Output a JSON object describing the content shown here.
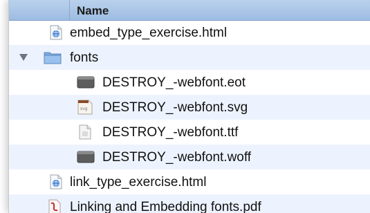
{
  "header": {
    "name_label": "Name"
  },
  "files": [
    {
      "label": "embed_type_exercise.html",
      "icon": "html-file-icon"
    },
    {
      "label": "fonts",
      "icon": "folder-icon",
      "expanded": true
    },
    {
      "label": "DESTROY_-webfont.eot",
      "icon": "eot-file-icon"
    },
    {
      "label": "DESTROY_-webfont.svg",
      "icon": "svg-file-icon"
    },
    {
      "label": "DESTROY_-webfont.ttf",
      "icon": "ttf-file-icon"
    },
    {
      "label": "DESTROY_-webfont.woff",
      "icon": "woff-file-icon"
    },
    {
      "label": "link_type_exercise.html",
      "icon": "html-file-icon"
    },
    {
      "label": "Linking and Embedding fonts.pdf",
      "icon": "pdf-file-icon"
    }
  ],
  "colors": {
    "header_gradient_top": "#b9d1ec",
    "header_gradient_bottom": "#9dbce2",
    "stripe": "#edf3fe",
    "folder": "#86b3e6"
  }
}
